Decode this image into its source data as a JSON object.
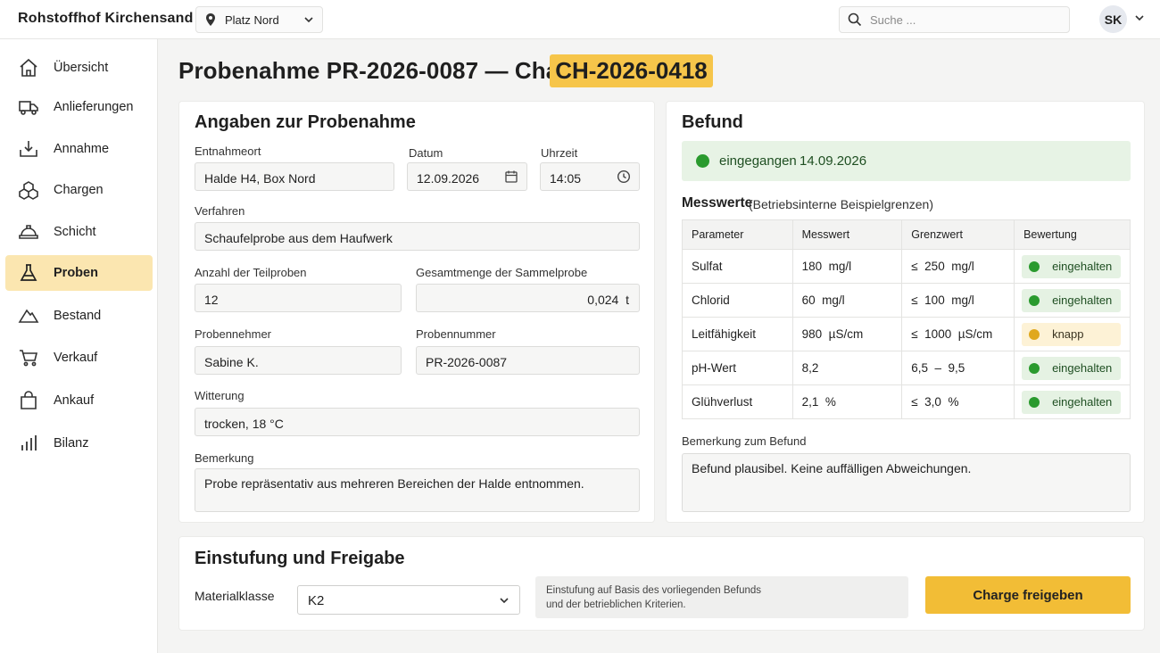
{
  "app": {
    "title": "Rohstoffhof Kirchensand"
  },
  "location": {
    "label": "Platz Nord",
    "icon": "map-pin-icon"
  },
  "search": {
    "placeholder": "Suche ..."
  },
  "user": {
    "initials": "SK"
  },
  "sidebar": {
    "items": [
      {
        "label": "Übersicht",
        "icon": "home-icon"
      },
      {
        "label": "Anlieferungen",
        "icon": "truck-icon"
      },
      {
        "label": "Annahme",
        "icon": "inbox-download-icon"
      },
      {
        "label": "Chargen",
        "icon": "boxes-icon"
      },
      {
        "label": "Schicht",
        "icon": "hard-hat-icon"
      },
      {
        "label": "Proben",
        "icon": "flask-icon",
        "active": true
      },
      {
        "label": "Bestand",
        "icon": "pile-icon"
      },
      {
        "label": "Verkauf",
        "icon": "cart-icon"
      },
      {
        "label": "Ankauf",
        "icon": "bag-icon"
      },
      {
        "label": "Bilanz",
        "icon": "bar-chart-icon"
      }
    ]
  },
  "page": {
    "title": "Probenahme PR-2026-0087 — Charge",
    "charge": "CH-2026-0418"
  },
  "sampling": {
    "title": "Angaben zur Probenahme",
    "location_label": "Entnahmeort",
    "location_value": "Halde H4, Box Nord",
    "date_label": "Datum",
    "date_value": "12.09.2026",
    "time_label": "Uhrzeit",
    "time_value": "14:05",
    "method_label": "Verfahren",
    "method_value": "Schaufelprobe aus dem Haufwerk",
    "count_label": "Anzahl der Teilproben",
    "count_value": "12",
    "amount_label": "Gesamtmenge der Sammelprobe",
    "amount_value": "0,024  t",
    "sampler_label": "Probennehmer",
    "sampler_value": "Sabine K.",
    "number_label": "Probennummer",
    "number_value": "PR-2026-0087",
    "weather_label": "Witterung",
    "weather_value": "trocken, 18 °C",
    "remark_label": "Bemerkung",
    "remark_value": "Probe repräsentativ aus mehreren Bereichen der Halde entnommen."
  },
  "finding": {
    "title": "Befund",
    "status": "eingegangen",
    "status_date": "14.09.2026",
    "status_color": "#2a9a2e",
    "measurements_title": "Messwerte",
    "measurements_subtitle": "(Betriebsinterne Beispielgrenzen)",
    "columns": [
      "Parameter",
      "Messwert",
      "Grenzwert",
      "Bewertung"
    ],
    "rows": [
      {
        "parameter": "Sulfat",
        "value": "180  mg/l",
        "limit": "≤  250  mg/l",
        "rating": "eingehalten",
        "level": "ok"
      },
      {
        "parameter": "Chlorid",
        "value": "60  mg/l",
        "limit": "≤  100  mg/l",
        "rating": "eingehalten",
        "level": "ok"
      },
      {
        "parameter": "Leitfähigkeit",
        "value": "980  µS/cm",
        "limit": "≤  1000  µS/cm",
        "rating": "knapp",
        "level": "warn"
      },
      {
        "parameter": "pH-Wert",
        "value": "8,2",
        "limit": "6,5  –  9,5",
        "rating": "eingehalten",
        "level": "ok"
      },
      {
        "parameter": "Glühverlust",
        "value": "2,1  %",
        "limit": "≤  3,0  %",
        "rating": "eingehalten",
        "level": "ok"
      }
    ],
    "remark_label": "Bemerkung zum Befund",
    "remark_value": "Befund plausibel. Keine auffälligen Abweichungen."
  },
  "release": {
    "title": "Einstufung und Freigabe",
    "class_label": "Materialklasse",
    "class_value": "K2",
    "note_line1": "Einstufung auf Basis des vorliegenden Befunds",
    "note_line2": "und der betrieblichen Kriterien.",
    "button_label": "Charge freigeben",
    "accent": "#f2bd36"
  }
}
